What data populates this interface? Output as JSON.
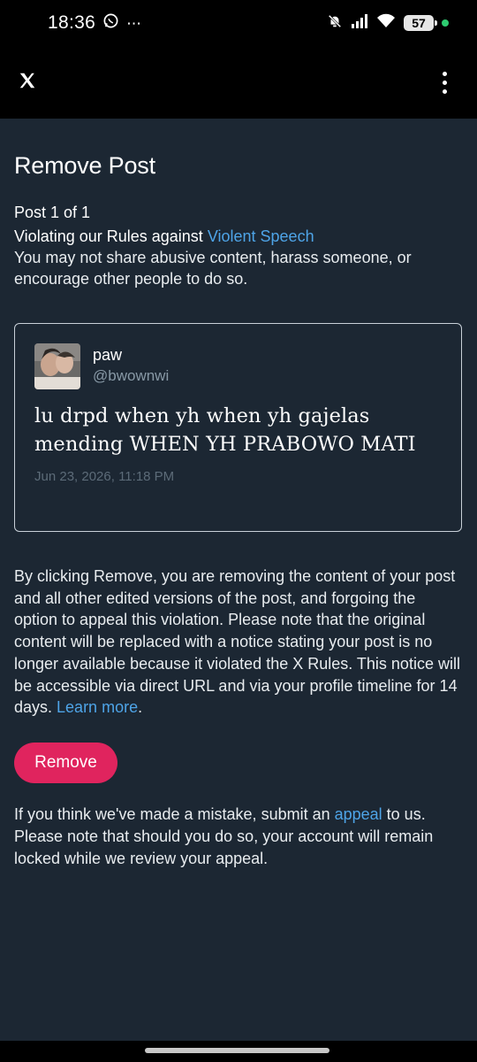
{
  "status_bar": {
    "time": "18:36",
    "battery": "57",
    "icons": [
      "whatsapp-icon",
      "more-dots-icon",
      "mute-bell-icon",
      "signal-icon",
      "wifi-icon",
      "battery-icon"
    ]
  },
  "app_bar": {
    "logo": "X",
    "menu_icon": "kebab-menu-icon"
  },
  "main": {
    "title": "Remove Post",
    "post_count": "Post 1 of 1",
    "violation_prefix": "Violating our Rules against ",
    "violation_link": "Violent Speech",
    "violation_description": "You may not share abusive content, harass someone, or encourage other people to do so.",
    "tweet": {
      "author_name": "paw",
      "author_handle": "@bwownwi",
      "text": "lu drpd when yh when yh gajelas mending WHEN YH PRABOWO MATI",
      "date": "Jun 23, 2026, 11:18 PM"
    },
    "explanation": "By clicking Remove, you are removing the content of your post and all other edited versions of the post, and forgoing the option to appeal this violation. Please note that the original content will be replaced with a notice stating your post is no longer available because it violated the X Rules. This notice will be accessible via direct URL and via your profile timeline for 14 days. ",
    "learn_more": "Learn more",
    "learn_more_suffix": ".",
    "remove_label": "Remove",
    "appeal_prefix": "If you think we've made a mistake, submit an ",
    "appeal_link": "appeal",
    "appeal_suffix": " to us. Please note that should you do so, your account will remain locked while we review your appeal."
  },
  "colors": {
    "background": "#1c2733",
    "link": "#4ea4e7",
    "remove_button": "#e0245e",
    "status_dot": "#2ecc71"
  }
}
